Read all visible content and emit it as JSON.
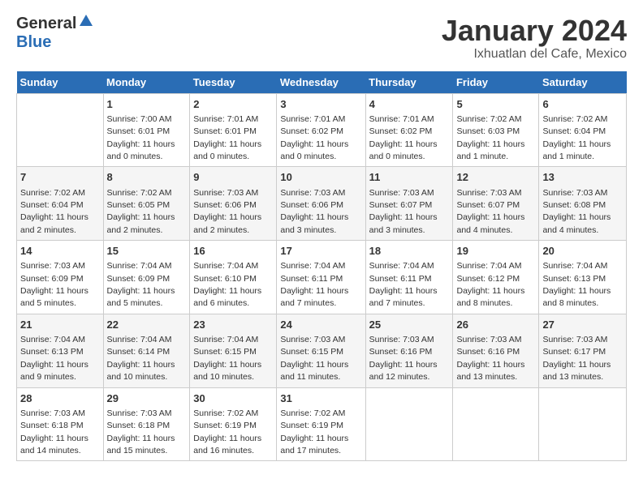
{
  "header": {
    "logo_general": "General",
    "logo_blue": "Blue",
    "month_title": "January 2024",
    "location": "Ixhuatlan del Cafe, Mexico"
  },
  "days_of_week": [
    "Sunday",
    "Monday",
    "Tuesday",
    "Wednesday",
    "Thursday",
    "Friday",
    "Saturday"
  ],
  "weeks": [
    [
      {
        "day": "",
        "info": ""
      },
      {
        "day": "1",
        "info": "Sunrise: 7:00 AM\nSunset: 6:01 PM\nDaylight: 11 hours\nand 0 minutes."
      },
      {
        "day": "2",
        "info": "Sunrise: 7:01 AM\nSunset: 6:01 PM\nDaylight: 11 hours\nand 0 minutes."
      },
      {
        "day": "3",
        "info": "Sunrise: 7:01 AM\nSunset: 6:02 PM\nDaylight: 11 hours\nand 0 minutes."
      },
      {
        "day": "4",
        "info": "Sunrise: 7:01 AM\nSunset: 6:02 PM\nDaylight: 11 hours\nand 0 minutes."
      },
      {
        "day": "5",
        "info": "Sunrise: 7:02 AM\nSunset: 6:03 PM\nDaylight: 11 hours\nand 1 minute."
      },
      {
        "day": "6",
        "info": "Sunrise: 7:02 AM\nSunset: 6:04 PM\nDaylight: 11 hours\nand 1 minute."
      }
    ],
    [
      {
        "day": "7",
        "info": "Sunrise: 7:02 AM\nSunset: 6:04 PM\nDaylight: 11 hours\nand 2 minutes."
      },
      {
        "day": "8",
        "info": "Sunrise: 7:02 AM\nSunset: 6:05 PM\nDaylight: 11 hours\nand 2 minutes."
      },
      {
        "day": "9",
        "info": "Sunrise: 7:03 AM\nSunset: 6:06 PM\nDaylight: 11 hours\nand 2 minutes."
      },
      {
        "day": "10",
        "info": "Sunrise: 7:03 AM\nSunset: 6:06 PM\nDaylight: 11 hours\nand 3 minutes."
      },
      {
        "day": "11",
        "info": "Sunrise: 7:03 AM\nSunset: 6:07 PM\nDaylight: 11 hours\nand 3 minutes."
      },
      {
        "day": "12",
        "info": "Sunrise: 7:03 AM\nSunset: 6:07 PM\nDaylight: 11 hours\nand 4 minutes."
      },
      {
        "day": "13",
        "info": "Sunrise: 7:03 AM\nSunset: 6:08 PM\nDaylight: 11 hours\nand 4 minutes."
      }
    ],
    [
      {
        "day": "14",
        "info": "Sunrise: 7:03 AM\nSunset: 6:09 PM\nDaylight: 11 hours\nand 5 minutes."
      },
      {
        "day": "15",
        "info": "Sunrise: 7:04 AM\nSunset: 6:09 PM\nDaylight: 11 hours\nand 5 minutes."
      },
      {
        "day": "16",
        "info": "Sunrise: 7:04 AM\nSunset: 6:10 PM\nDaylight: 11 hours\nand 6 minutes."
      },
      {
        "day": "17",
        "info": "Sunrise: 7:04 AM\nSunset: 6:11 PM\nDaylight: 11 hours\nand 7 minutes."
      },
      {
        "day": "18",
        "info": "Sunrise: 7:04 AM\nSunset: 6:11 PM\nDaylight: 11 hours\nand 7 minutes."
      },
      {
        "day": "19",
        "info": "Sunrise: 7:04 AM\nSunset: 6:12 PM\nDaylight: 11 hours\nand 8 minutes."
      },
      {
        "day": "20",
        "info": "Sunrise: 7:04 AM\nSunset: 6:13 PM\nDaylight: 11 hours\nand 8 minutes."
      }
    ],
    [
      {
        "day": "21",
        "info": "Sunrise: 7:04 AM\nSunset: 6:13 PM\nDaylight: 11 hours\nand 9 minutes."
      },
      {
        "day": "22",
        "info": "Sunrise: 7:04 AM\nSunset: 6:14 PM\nDaylight: 11 hours\nand 10 minutes."
      },
      {
        "day": "23",
        "info": "Sunrise: 7:04 AM\nSunset: 6:15 PM\nDaylight: 11 hours\nand 10 minutes."
      },
      {
        "day": "24",
        "info": "Sunrise: 7:03 AM\nSunset: 6:15 PM\nDaylight: 11 hours\nand 11 minutes."
      },
      {
        "day": "25",
        "info": "Sunrise: 7:03 AM\nSunset: 6:16 PM\nDaylight: 11 hours\nand 12 minutes."
      },
      {
        "day": "26",
        "info": "Sunrise: 7:03 AM\nSunset: 6:16 PM\nDaylight: 11 hours\nand 13 minutes."
      },
      {
        "day": "27",
        "info": "Sunrise: 7:03 AM\nSunset: 6:17 PM\nDaylight: 11 hours\nand 13 minutes."
      }
    ],
    [
      {
        "day": "28",
        "info": "Sunrise: 7:03 AM\nSunset: 6:18 PM\nDaylight: 11 hours\nand 14 minutes."
      },
      {
        "day": "29",
        "info": "Sunrise: 7:03 AM\nSunset: 6:18 PM\nDaylight: 11 hours\nand 15 minutes."
      },
      {
        "day": "30",
        "info": "Sunrise: 7:02 AM\nSunset: 6:19 PM\nDaylight: 11 hours\nand 16 minutes."
      },
      {
        "day": "31",
        "info": "Sunrise: 7:02 AM\nSunset: 6:19 PM\nDaylight: 11 hours\nand 17 minutes."
      },
      {
        "day": "",
        "info": ""
      },
      {
        "day": "",
        "info": ""
      },
      {
        "day": "",
        "info": ""
      }
    ]
  ]
}
